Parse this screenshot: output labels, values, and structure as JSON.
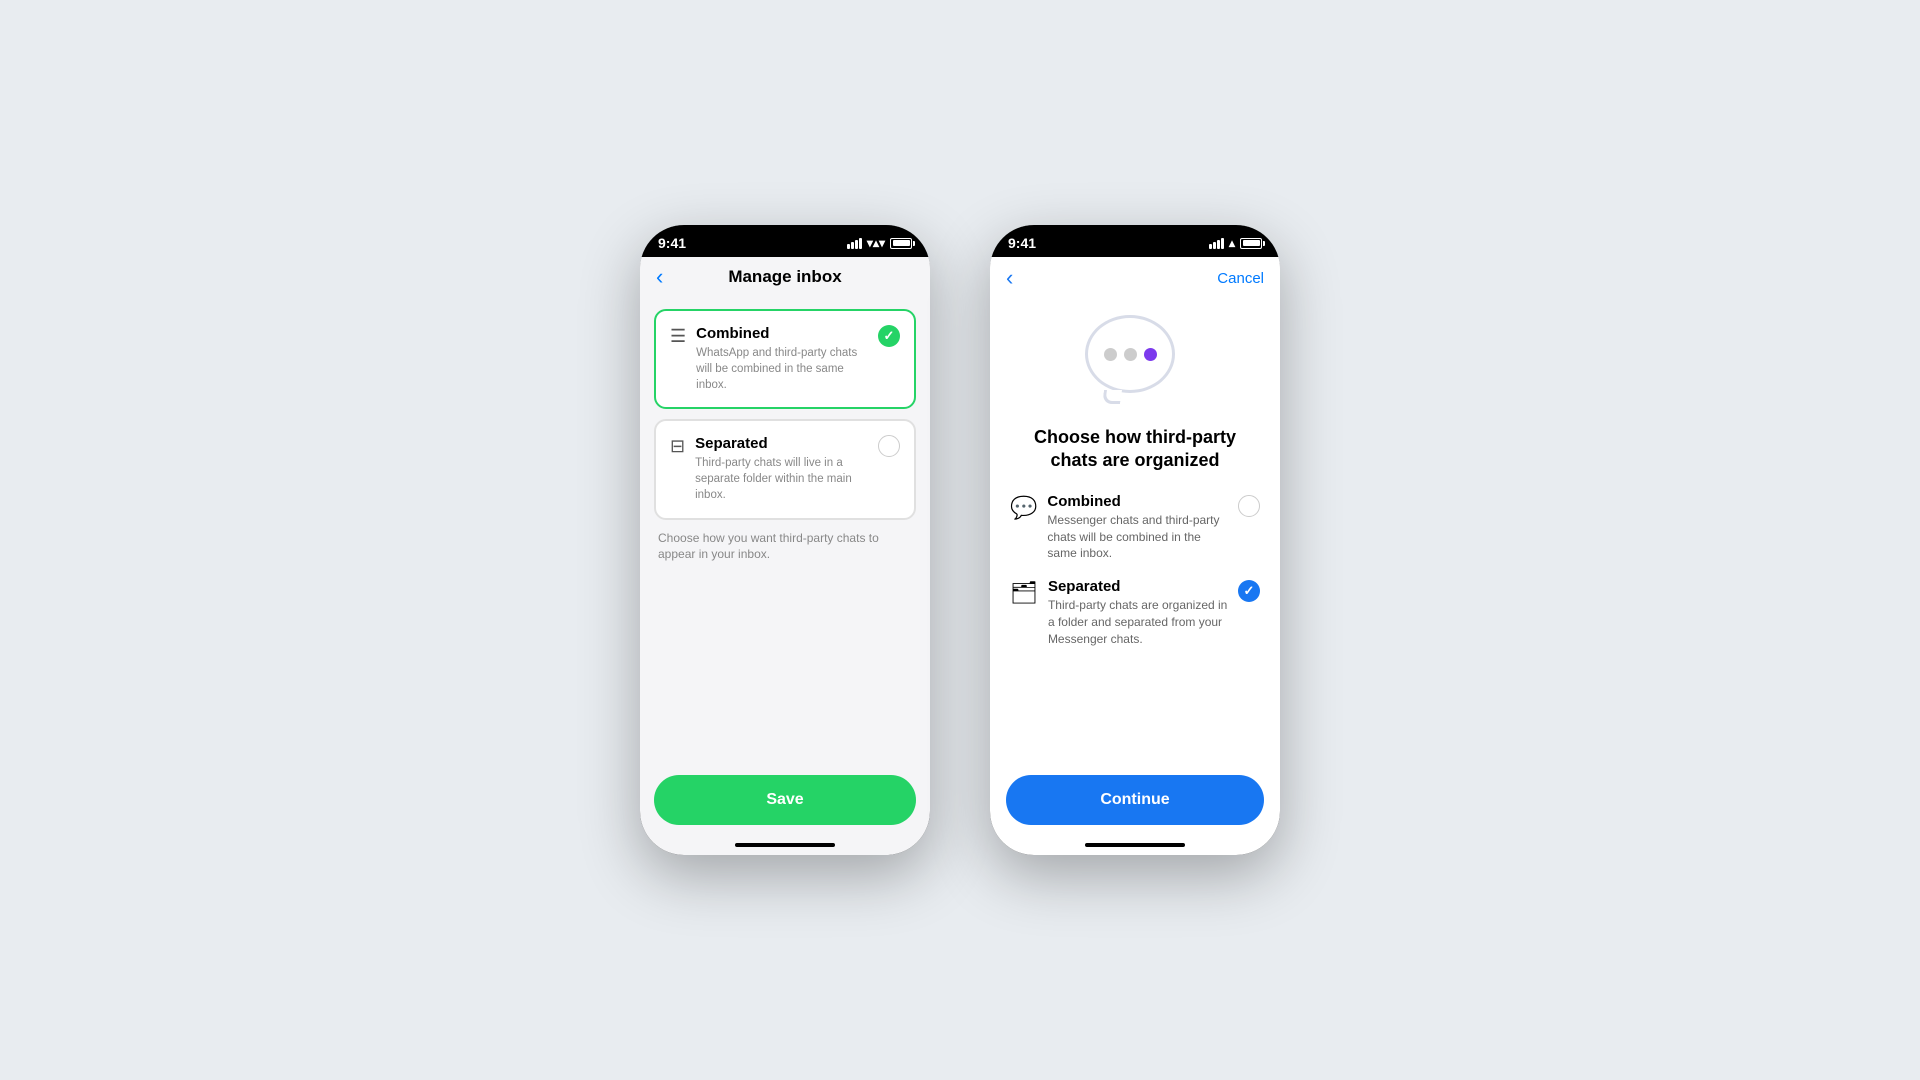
{
  "background_color": "#e8ecf0",
  "left_phone": {
    "status_bar": {
      "time": "9:41",
      "battery_full": true
    },
    "nav": {
      "back_label": "‹",
      "title": "Manage inbox"
    },
    "options": [
      {
        "id": "combined",
        "title": "Combined",
        "description": "WhatsApp and third-party chats will be combined in the same inbox.",
        "selected": true,
        "icon": "≡"
      },
      {
        "id": "separated",
        "title": "Separated",
        "description": "Third-party chats will live in a separate folder within the main inbox.",
        "selected": false,
        "icon": "⊟"
      }
    ],
    "helper_text": "Choose how you want third-party chats to appear in your inbox.",
    "save_button_label": "Save"
  },
  "right_phone": {
    "status_bar": {
      "time": "9:41",
      "battery_full": true
    },
    "nav": {
      "back_label": "‹",
      "cancel_label": "Cancel"
    },
    "modal_title": "Choose how third-party chats are organized",
    "options": [
      {
        "id": "combined",
        "title": "Combined",
        "description": "Messenger chats and third-party chats will be combined in the same inbox.",
        "selected": false,
        "icon": "💬"
      },
      {
        "id": "separated",
        "title": "Separated",
        "description": "Third-party chats are organized in a folder and separated from your Messenger chats.",
        "selected": true,
        "icon": "📁"
      }
    ],
    "continue_button_label": "Continue"
  }
}
